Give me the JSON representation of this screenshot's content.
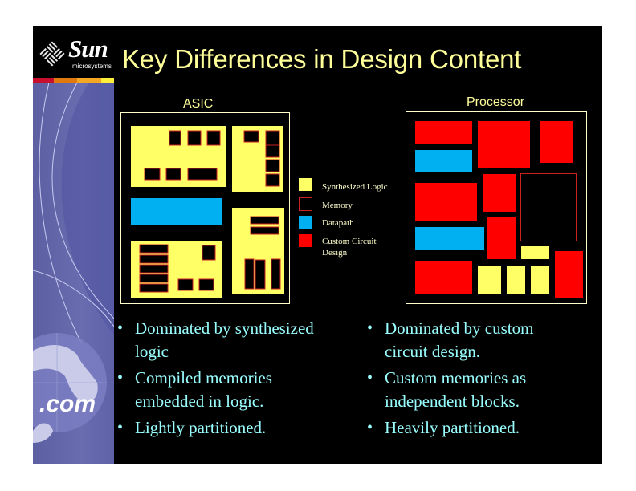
{
  "slide": {
    "title": "Key Differences in Design Content",
    "logo": {
      "brand": "Sun",
      "subtitle": "microsystems",
      "icon": "sun-logo-icon"
    },
    "sidebar": {
      "tagline": ".com",
      "icon": "globe-icon",
      "stripe_colors": [
        "#c8102e",
        "#e07a10",
        "#f5a623",
        "#ffef3a"
      ]
    }
  },
  "colors": {
    "synthesized_logic": "#ffff66",
    "memory_outline": "#cc2222",
    "datapath": "#00b0f0",
    "custom_circuit": "#ff0000",
    "frame": "#ffffcc",
    "title": "#ffff99",
    "bullet_text": "#99ffff"
  },
  "asic": {
    "label": "ASIC",
    "bullets": [
      "Dominated by synthesized logic",
      "Compiled memories embedded in logic.",
      "Lightly partitioned."
    ]
  },
  "processor": {
    "label": "Processor",
    "bullets": [
      "Dominated by custom circuit design.",
      "Custom memories as independent blocks.",
      "Heavily partitioned."
    ]
  },
  "legend": [
    {
      "key": "synthesized_logic",
      "label": "Synthesized Logic"
    },
    {
      "key": "memory",
      "label": "Memory"
    },
    {
      "key": "datapath",
      "label": "Datapath"
    },
    {
      "key": "custom_circuit",
      "label": "Custom Circuit Design"
    }
  ]
}
